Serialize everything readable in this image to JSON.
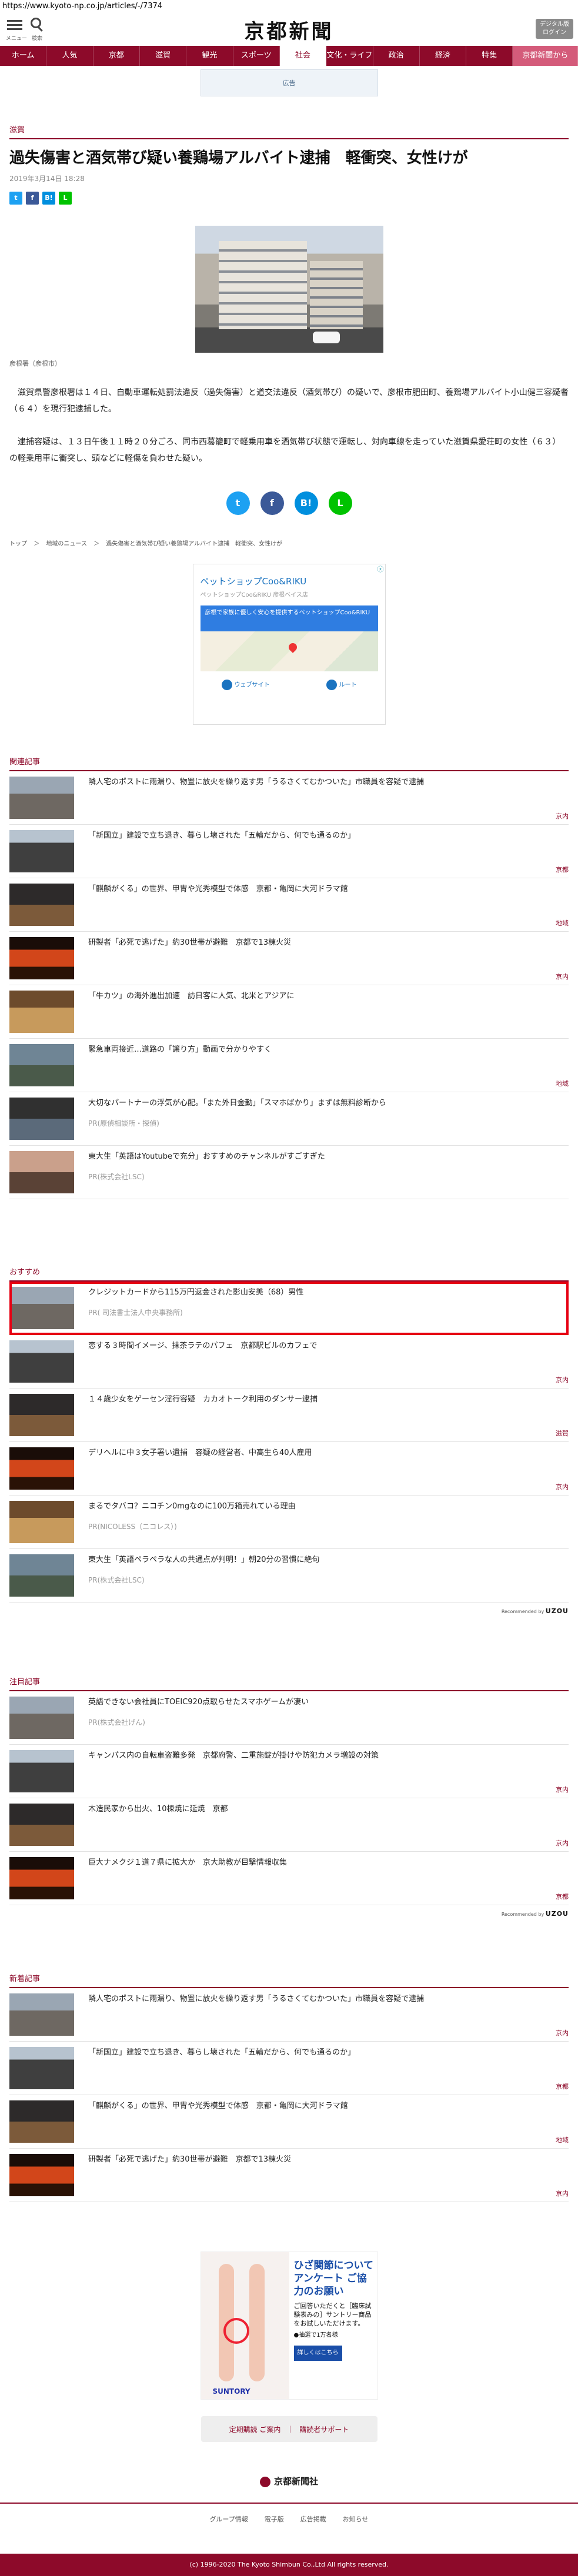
{
  "browser": {
    "url": "https://www.kyoto-np.co.jp/articles/-/7374"
  },
  "header": {
    "menu_label": "メニュー",
    "search_label": "検索",
    "logo": "京都新聞",
    "digital_btn": "デジタル版\nログイン"
  },
  "nav": [
    "ホーム",
    "人気",
    "京都",
    "滋賀",
    "観光",
    "スポーツ",
    "社会",
    "文化・ライフ",
    "政治",
    "経済",
    "特集",
    "京都新聞から"
  ],
  "nav_active": "社会",
  "top_ad": "広告",
  "article": {
    "category": "滋賀",
    "title": "過失傷害と酒気帯び疑い養鶏場アルバイト逮捕　軽衝突、女性けが",
    "date": "2019年3月14日 18:28",
    "caption": "彦根署（彦根市）",
    "p1": "　滋賀県警彦根署は１４日、自動車運転処罰法違反（過失傷害）と道交法違反（酒気帯び）の疑いで、彦根市肥田町、養鶏場アルバイト小山健三容疑者（６４）を現行犯逮捕した。",
    "p2": "　逮捕容疑は、１３日午後１１時２０分ごろ、同市西葛籠町で軽乗用車を酒気帯び状態で運転し、対向車線を走っていた滋賀県愛荘町の女性（６３）の軽乗用車に衝突し、頭などに軽傷を負わせた疑い。"
  },
  "share_small": [
    "t",
    "f",
    "B!",
    "L"
  ],
  "share_big": [
    "t",
    "f",
    "B!",
    "L"
  ],
  "breadcrumb": [
    "トップ",
    "＞",
    "地域のニュース",
    "＞",
    "過失傷害と酒気帯び疑い養鶏場アルバイト逮捕　軽衝突、女性けが"
  ],
  "map_ad": {
    "close": "ⓧ",
    "title": "ペットショップCoo&RIKU",
    "subtitle": "ペットショップCoo&RIKU 彦根ベイス店",
    "banner": "彦根で家族に優しく安心を提供するペットショップCoo&RIKU",
    "btn_web": "ウェブサイト",
    "btn_route": "ルート"
  },
  "related": {
    "title": "関連記事",
    "items": [
      {
        "text": "隣人宅のポストに雨漏り、物置に放火を繰り返す男「うるさくてむかついた」市職員を容疑で逮捕",
        "tag": "京内"
      },
      {
        "text": "「新国立」建設で立ち退き、暮らし壊された「五輪だから、何でも通るのか」",
        "tag": "京都"
      },
      {
        "text": "「麒麟がくる」の世界、甲冑や光秀模型で体感　京都・亀岡に大河ドラマ館",
        "tag": "地域"
      },
      {
        "text": "研製者「必死で逃げた」約30世帯が避難　京都で13棟火災",
        "tag": "京内"
      },
      {
        "text": "「牛カツ」の海外進出加速　訪日客に人気、北米とアジアに",
        "tag": ""
      },
      {
        "text": "緊急車両接近…道路の「譲り方」動画で分かりやすく",
        "tag": "地域"
      },
      {
        "text": "大切なパートナーの浮気が心配。「また外日金勤」「スマホばかり」まずは無料診断から",
        "sub": "PR(原偵相談所・探偵)",
        "tag": ""
      },
      {
        "text": "東大生「英語はYoutubeで充分」おすすめのチャンネルがすごすぎた",
        "sub": "PR(株式会社LSC)",
        "tag": ""
      }
    ]
  },
  "recommend": {
    "title": "おすすめ",
    "items": [
      {
        "text": "クレジットカードから115万円返金された影山安美（68）男性",
        "sub": "PR(  司法書士法人中央事務所)",
        "tag": ""
      },
      {
        "text": "恋する３時間イメージ、抹茶ラテのパフェ　京都駅ビルのカフェで",
        "tag": "京内"
      },
      {
        "text": "１４歳少女をゲーセン淫行容疑　カカオトーク利用のダンサー逮捕",
        "tag": "滋賀"
      },
      {
        "text": "デリヘルに中３女子署い遺捕　容疑の経営者、中高生ら40人雇用",
        "tag": "京内"
      },
      {
        "text": "まるでタバコ？ニコチン0mgなのに100万箱売れている理由",
        "sub": "PR(NICOLESS（ニコレス）)",
        "tag": ""
      },
      {
        "text": "東大生「英語ペラペラな人の共通点が判明！」朝20分の習慣に絶句",
        "sub": "PR(株式会社LSC)",
        "tag": ""
      }
    ],
    "powered_label": "Recommended by",
    "powered_brand": "UZOU"
  },
  "noted": {
    "title": "注目記事",
    "items": [
      {
        "text": "英語できない会社員にTOEIC920点取らせたスマホゲームが凄い",
        "sub": "PR(株式会社げん)",
        "tag": ""
      },
      {
        "text": "キャンパス内の自転車盗難多発　京都府警、二重施錠が掛けや防犯カメラ増設の対策",
        "tag": "京内"
      },
      {
        "text": "木造民家から出火、10棟焼に延焼　京都",
        "tag": "京内"
      },
      {
        "text": "巨大ナメクジ１道７県に拡大か　京大助教が目撃情報収集",
        "tag": "京都"
      }
    ],
    "powered_label": "Recommended by",
    "powered_brand": "UZOU"
  },
  "latest": {
    "title": "新着記事",
    "items": [
      {
        "text": "隣人宅のポストに雨漏り、物置に放火を繰り返す男「うるさくてむかついた」市職員を容疑で逮捕",
        "tag": "京内"
      },
      {
        "text": "「新国立」建設で立ち退き、暮らし壊された「五輪だから、何でも通るのか」",
        "tag": "京都"
      },
      {
        "text": "「麒麟がくる」の世界、甲冑や光秀模型で体感　京都・亀岡に大河ドラマ館",
        "tag": "地域"
      },
      {
        "text": "研製者「必死で逃げた」約30世帯が避難　京都で13棟火災",
        "tag": "京内"
      }
    ]
  },
  "bottom_ad": {
    "headline": "ひざ関節について アンケート ご協力のお願い",
    "body": "ご回答いただくと［臨床試験表みの］サントリー商品をお試しいただけます。",
    "note": "●抽選で1万名様",
    "cta": "詳しくはこちら",
    "brand": "SUNTORY"
  },
  "pill": {
    "left": "定期購読 ご案内",
    "sep": "｜",
    "right": "購読者サポート"
  },
  "footer": {
    "logo": "京都新聞社",
    "links": [
      "グループ情報",
      "電子版",
      "広告掲載",
      "お知らせ"
    ],
    "copyright": "(c) 1996-2020 The Kyoto Shimbun Co.,Ltd All rights reserved."
  },
  "colors": {
    "brand": "#8d0a2a",
    "highlight": "#e60012"
  }
}
